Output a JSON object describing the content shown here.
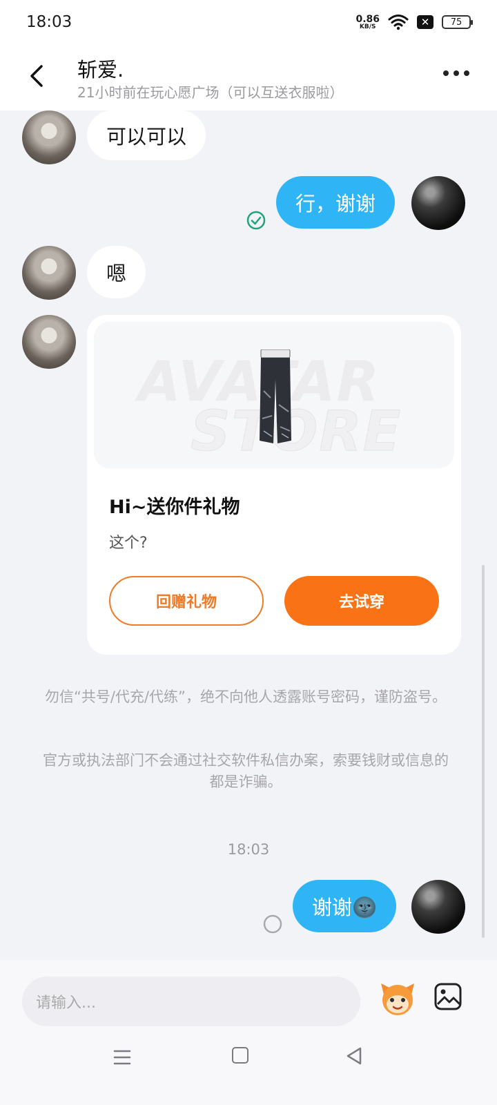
{
  "status": {
    "time": "18:03",
    "net_speed": "0.86",
    "net_unit": "KB/S",
    "battery": "75"
  },
  "header": {
    "title": "斩爱.",
    "subtitle": "21小时前在玩心愿广场（可以互送衣服啦）"
  },
  "messages": [
    {
      "side": "in",
      "text": "可以可以"
    },
    {
      "side": "out",
      "text": "行，谢谢",
      "read": true
    },
    {
      "side": "in",
      "text": "嗯"
    },
    {
      "side": "out",
      "text": "谢谢🌚",
      "read": false
    }
  ],
  "gift_card": {
    "watermark_line1": "AVATAR",
    "watermark_line2": "STORE",
    "title": "Hi~送你件礼物",
    "desc": "这个?",
    "return_label": "回赠礼物",
    "try_label": "去试穿"
  },
  "notices": [
    "勿信“共号/代充/代练”，绝不向他人透露账号密码，谨防盗号。",
    "官方或执法部门不会通过社交软件私信办案，索要钱财或信息的都是诈骗。"
  ],
  "time_stamp": "18:03",
  "input": {
    "placeholder": "请输入..."
  },
  "colors": {
    "outgoing_bubble": "#2fb5f5",
    "accent_orange": "#f97316",
    "read_check": "#1fa37a"
  },
  "icons": [
    "back-arrow-icon",
    "more-icon",
    "read-check-icon",
    "sending-icon",
    "emoji-icon",
    "image-icon",
    "menu-icon",
    "home-icon",
    "back-triangle-icon"
  ]
}
